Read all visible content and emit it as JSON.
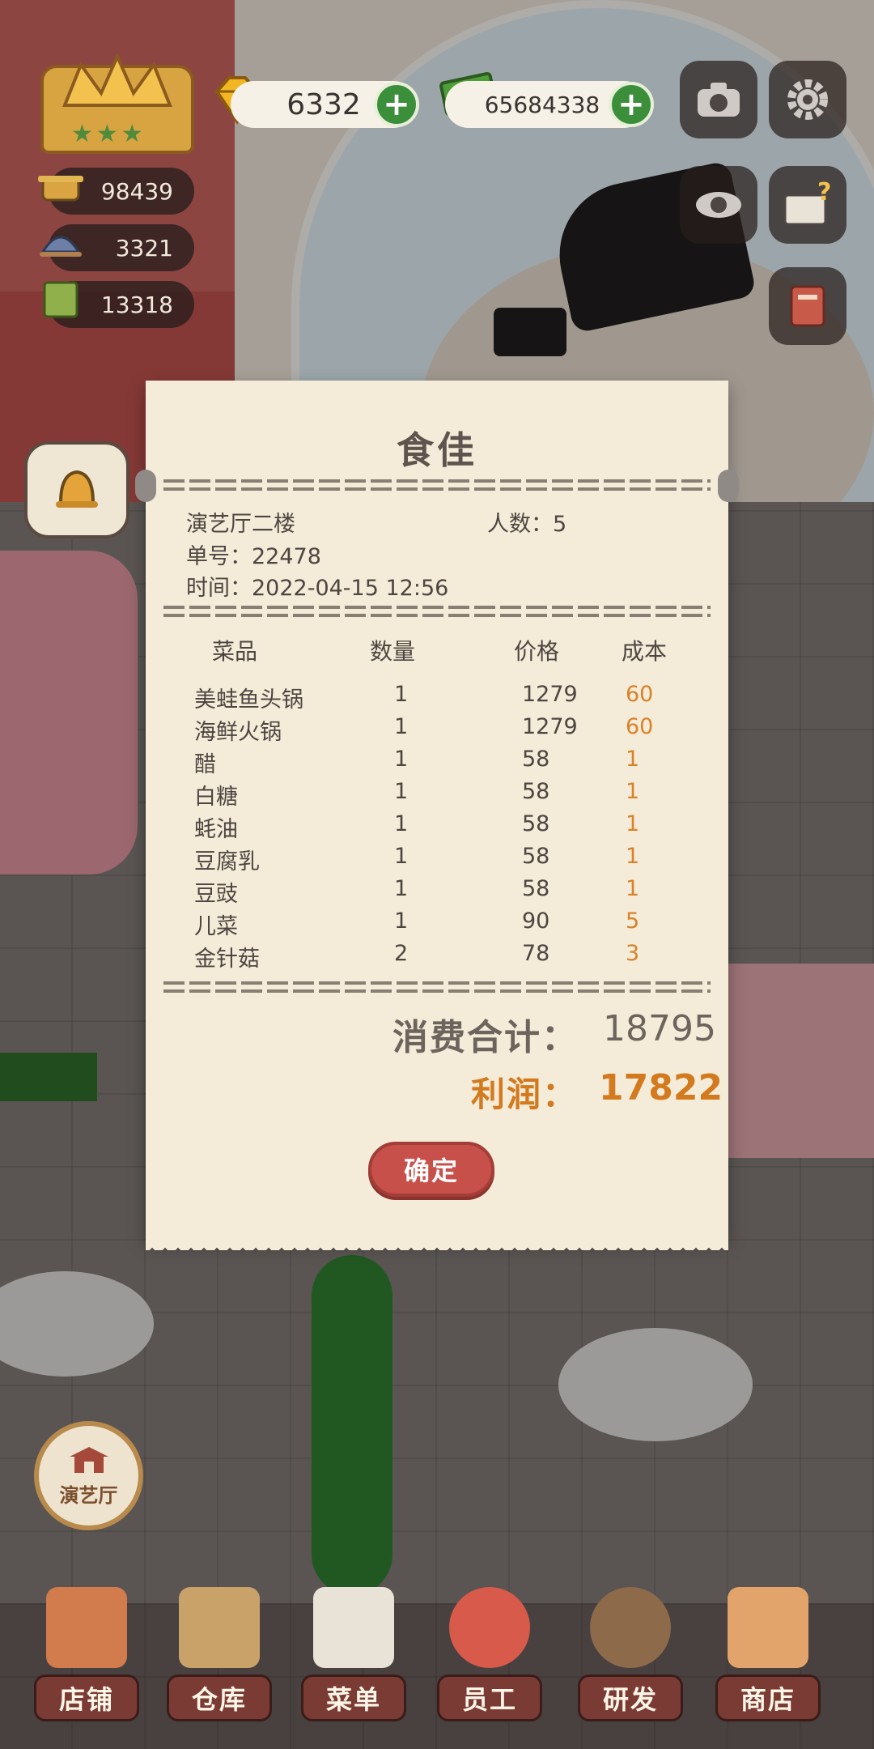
{
  "hud": {
    "gems": "6332",
    "cash": "65684338",
    "stat_pot": "98439",
    "stat_dish": "3321",
    "stat_book": "13318"
  },
  "receipt": {
    "title": "食佳",
    "location": "演艺厅二楼",
    "guests_label": "人数：5",
    "order_no": "单号：22478",
    "time": "时间：2022-04-15 12:56",
    "columns": {
      "dish": "菜品",
      "qty": "数量",
      "price": "价格",
      "cost": "成本"
    },
    "items": [
      {
        "dish": "美蛙鱼头锅",
        "qty": "1",
        "price": "1279",
        "cost": "60"
      },
      {
        "dish": "海鲜火锅",
        "qty": "1",
        "price": "1279",
        "cost": "60"
      },
      {
        "dish": "醋",
        "qty": "1",
        "price": "58",
        "cost": "1"
      },
      {
        "dish": "白糖",
        "qty": "1",
        "price": "58",
        "cost": "1"
      },
      {
        "dish": "蚝油",
        "qty": "1",
        "price": "58",
        "cost": "1"
      },
      {
        "dish": "豆腐乳",
        "qty": "1",
        "price": "58",
        "cost": "1"
      },
      {
        "dish": "豆豉",
        "qty": "1",
        "price": "58",
        "cost": "1"
      },
      {
        "dish": "儿菜",
        "qty": "1",
        "price": "90",
        "cost": "5"
      },
      {
        "dish": "金针菇",
        "qty": "2",
        "price": "78",
        "cost": "3"
      }
    ],
    "total_label": "消费合计：",
    "total_value": "18795",
    "profit_label": "利润：",
    "profit_value": "17822",
    "confirm": "确定"
  },
  "location_badge": "演艺厅",
  "nav": [
    "店铺",
    "仓库",
    "菜单",
    "员工",
    "研发",
    "商店"
  ],
  "icons": [
    "crown-badge-icon",
    "gem-icon",
    "cash-icon",
    "plus-icon",
    "camera-icon",
    "gear-icon",
    "eye-icon",
    "guide-book-icon",
    "recipe-book-icon",
    "bell-icon",
    "pot-icon",
    "cloche-icon",
    "book-icon",
    "building-icon"
  ],
  "colors": {
    "accent": "#c8504a",
    "profit": "#d37a1f",
    "paper": "#f4ecd8",
    "nav": "#7b3b35"
  }
}
